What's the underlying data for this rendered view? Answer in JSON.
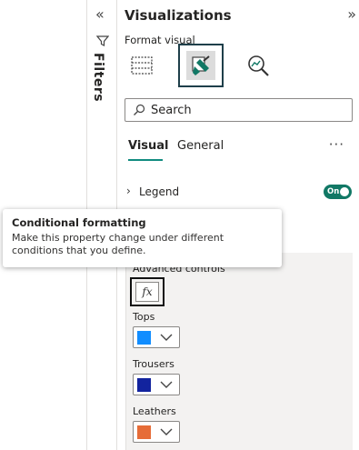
{
  "filters_pane": {
    "label": "Filters",
    "collapse_glyph": "«"
  },
  "viz_pane": {
    "title": "Visualizations",
    "expand_glyph": "»",
    "subtitle": "Format visual",
    "build_icons": [
      "table-grid-icon",
      "paintbrush-format-icon",
      "magnify-analytics-icon"
    ],
    "search": {
      "placeholder": "Search"
    },
    "tabs": [
      {
        "label": "Visual",
        "active": true
      },
      {
        "label": "General",
        "active": false
      }
    ],
    "more_glyph": "···",
    "legend": {
      "label": "Legend",
      "toggle_text": "On"
    },
    "advanced": {
      "label": "Advanced controls",
      "fx_label": "fx",
      "series": [
        {
          "name": "Tops",
          "color": "#118dff"
        },
        {
          "name": "Trousers",
          "color": "#12239e"
        },
        {
          "name": "Leathers",
          "color": "#e66c37"
        }
      ]
    }
  },
  "tooltip": {
    "title": "Conditional formatting",
    "description": "Make this property change under different conditions that you define."
  },
  "colors": {
    "accent": "#117865",
    "tab_underline": "#118b7f",
    "highlight_border": "#1f3f4a"
  }
}
